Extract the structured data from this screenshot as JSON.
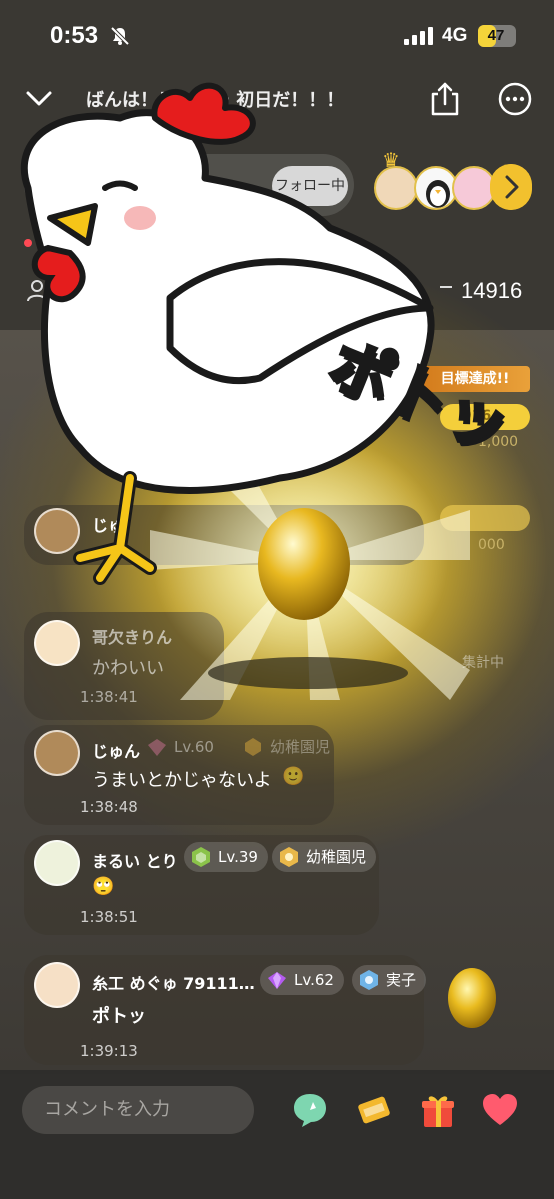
{
  "status_bar": {
    "time": "0:53",
    "network": "4G",
    "battery": "47",
    "battery_level": 0.47
  },
  "header": {
    "title": "ばんは！！！ルー 初日だ！！！"
  },
  "streamer": {
    "follow_label": "フォロー中"
  },
  "live_duration": "0",
  "viewer_count": "14916",
  "goal": {
    "banner": "目標達成!!",
    "current": "916",
    "target": "1,000",
    "target2": "000",
    "count_status": "集計中"
  },
  "effect": {
    "label": "ポトッ"
  },
  "comments": [
    {
      "name": "じゅ",
      "text": "",
      "time": ""
    },
    {
      "name": "哥欠きりん",
      "text": "かわいい",
      "time": "1:38:41"
    },
    {
      "name": "じゅん",
      "level": "Lv.60",
      "title": "幼稚園児",
      "text": "うまいとかじゃないよ",
      "emoji": "🙂",
      "time": "1:38:48"
    },
    {
      "name": "まるい とり",
      "level": "Lv.39",
      "title": "幼稚園児",
      "text": "",
      "emoji": "🙄",
      "time": "1:38:51"
    },
    {
      "name": "糸工 めぐゅ 79111…",
      "level": "Lv.62",
      "title": "実子",
      "text": "ポトッ",
      "time": "1:39:13"
    }
  ],
  "input": {
    "placeholder": "コメントを入力"
  },
  "colors": {
    "accent": "#f2c12e",
    "live": "#ff4a55",
    "heart": "#ff5b6e",
    "egg": "#e8b820"
  }
}
